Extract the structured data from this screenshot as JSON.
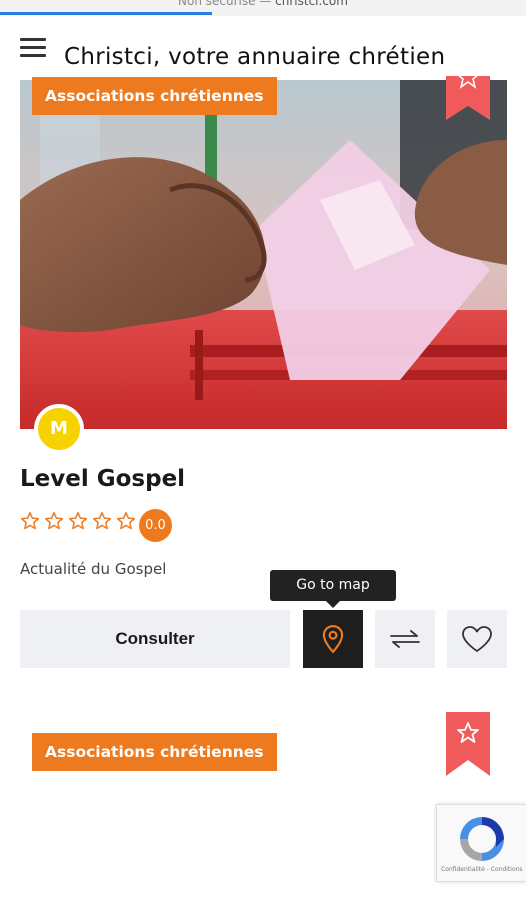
{
  "browser": {
    "url_prefix": "Non sécurisé — ",
    "url_host": "christci.com"
  },
  "header": {
    "menu_icon": "hamburger-menu-icon",
    "title": "Christci, votre annuaire chrétien"
  },
  "card1": {
    "category": "Associations chrétiennes",
    "bookmark_icon": "star-icon",
    "image": "hand-dropping-ballot-into-box",
    "avatar_letter": "M",
    "title": "Level Gospel",
    "rating_stars": 0,
    "rating_max": 5,
    "rating_value": "0.0",
    "description": "Actualité du Gospel",
    "tooltip": "Go to map",
    "consult_label": "Consulter",
    "map_icon": "map-pin-icon",
    "compare_icon": "compare-arrows-icon",
    "favorite_icon": "heart-icon"
  },
  "card2": {
    "category": "Associations chrétiennes",
    "bookmark_icon": "star-icon"
  },
  "recaptcha": {
    "terms": "Confidentialité - Conditions"
  },
  "colors": {
    "accent": "#ee7a1f",
    "ribbon": "#f05a5a",
    "avatar": "#f5d200",
    "button_bg": "#eef0f3",
    "map_button_bg": "#1e1e1e"
  }
}
